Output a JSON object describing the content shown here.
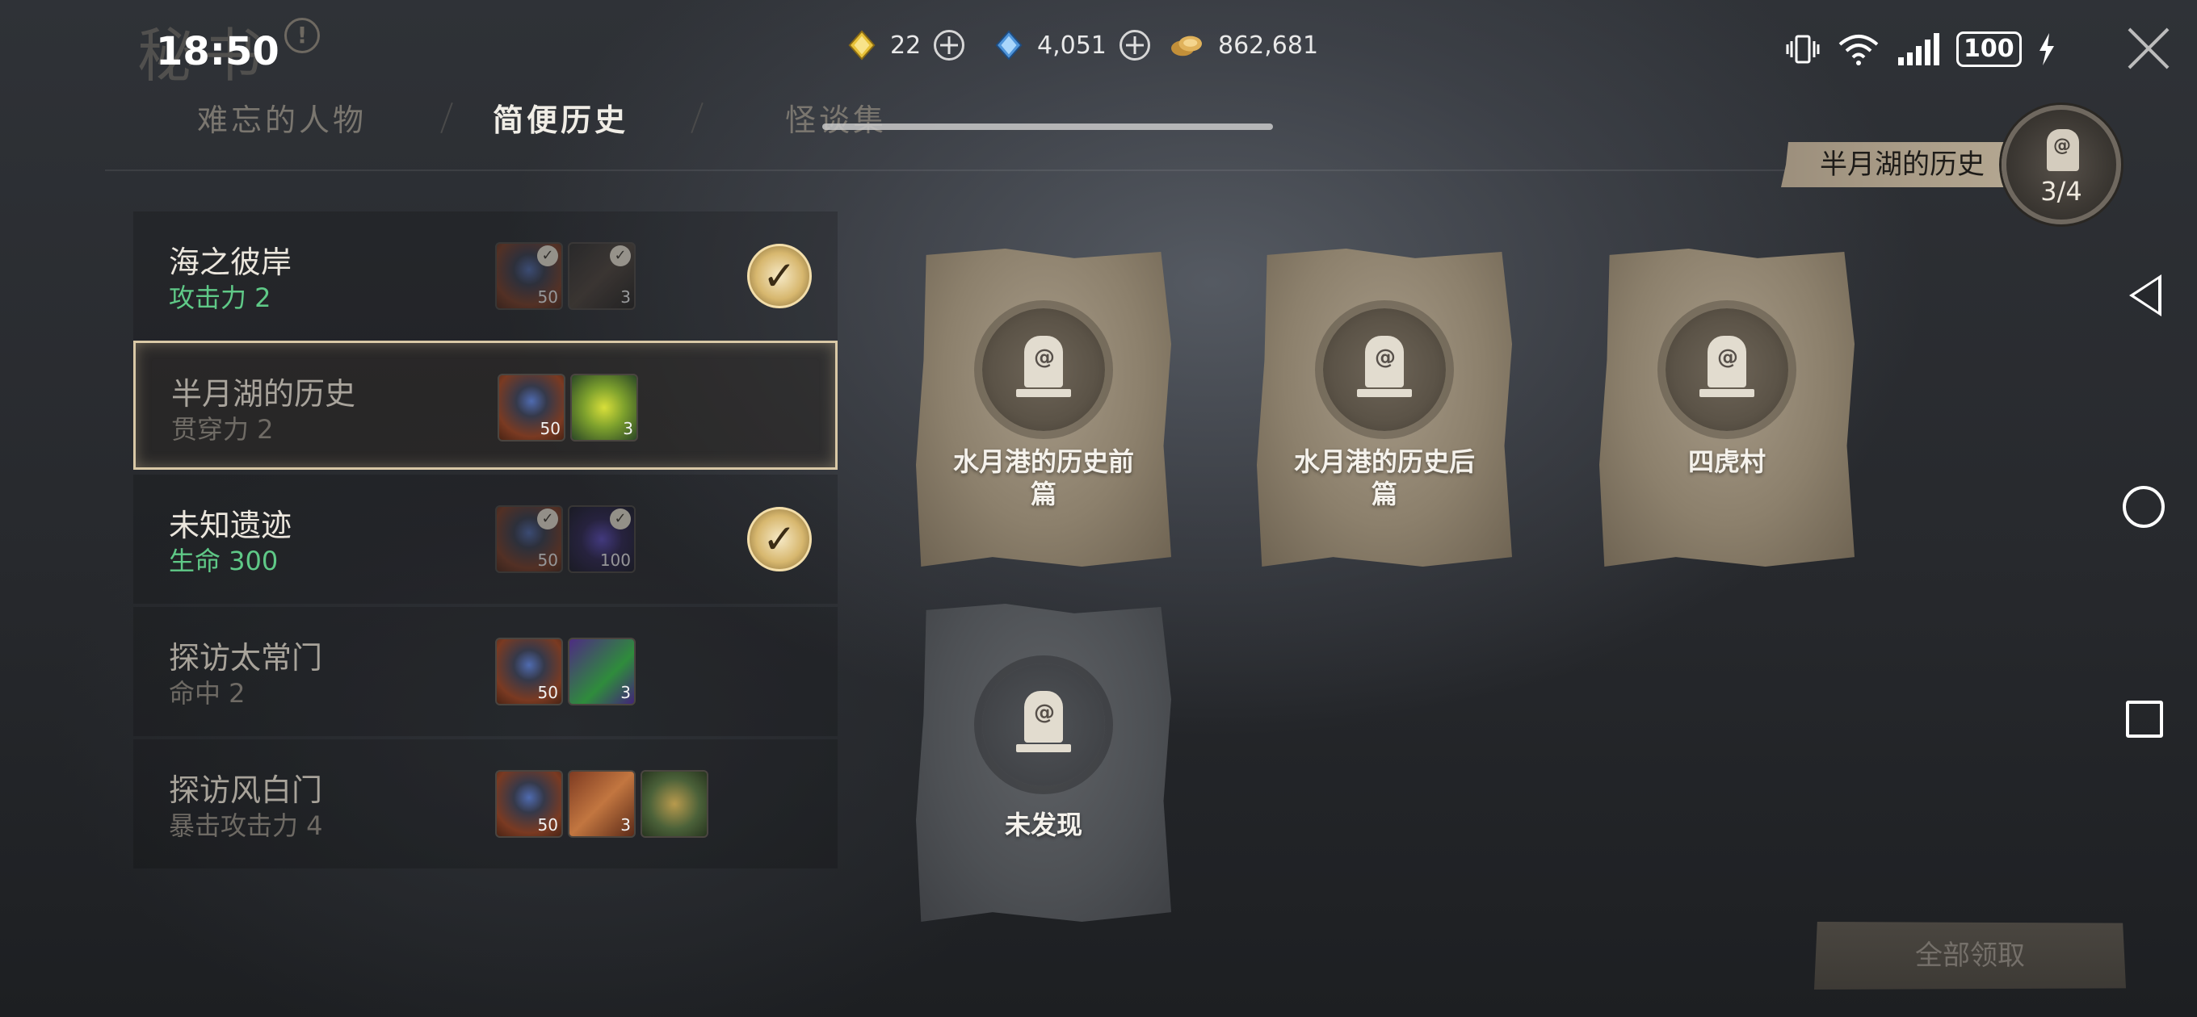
{
  "header": {
    "title_art": "秘书",
    "clock": "18:50"
  },
  "currencies": [
    {
      "icon": "yellow-diamond-icon",
      "value": "22",
      "color": "#e8c23a"
    },
    {
      "icon": "blue-diamond-icon",
      "value": "4,051",
      "color": "#5aa7e8"
    },
    {
      "icon": "coins-icon",
      "value": "862,681",
      "color": "#d2a24a"
    }
  ],
  "status_bar": {
    "battery": "100",
    "icons": [
      "vibrate-icon",
      "wifi-icon",
      "signal-icon",
      "battery-icon",
      "charging-icon"
    ]
  },
  "tabs": [
    {
      "label": "难忘的人物",
      "active": false
    },
    {
      "label": "简便历史",
      "active": true
    },
    {
      "label": "怪谈集",
      "active": false
    }
  ],
  "region": {
    "label": "半月湖的历史",
    "progress": "3/4"
  },
  "quests": [
    {
      "title": "海之彼岸",
      "reward_stat": "攻击力 2",
      "state": "done",
      "items": [
        {
          "kind": "bag",
          "qty": "50",
          "claimed": true
        },
        {
          "kind": "chest-dark",
          "qty": "3",
          "claimed": true
        }
      ]
    },
    {
      "title": "半月湖的历史",
      "reward_stat": "贯穿力 2",
      "state": "selected",
      "items": [
        {
          "kind": "bag",
          "qty": "50",
          "claimed": false
        },
        {
          "kind": "chest-green",
          "qty": "3",
          "claimed": false
        }
      ]
    },
    {
      "title": "未知遗迹",
      "reward_stat": "生命 300",
      "state": "done",
      "items": [
        {
          "kind": "bag",
          "qty": "50",
          "claimed": true
        },
        {
          "kind": "star",
          "qty": "100",
          "claimed": true
        }
      ]
    },
    {
      "title": "探访太常门",
      "reward_stat": "命中 2",
      "state": "pending",
      "items": [
        {
          "kind": "bag",
          "qty": "50",
          "claimed": false
        },
        {
          "kind": "card",
          "qty": "3",
          "claimed": false
        }
      ]
    },
    {
      "title": "探访风白门",
      "reward_stat": "暴击攻击力 4",
      "state": "pending",
      "items": [
        {
          "kind": "bag",
          "qty": "50",
          "claimed": false
        },
        {
          "kind": "scroll",
          "qty": "3",
          "claimed": false
        },
        {
          "kind": "box-green",
          "qty": "",
          "claimed": false
        }
      ]
    }
  ],
  "records": [
    {
      "title": "水月港的历史前篇",
      "line1": "水月港的历史前",
      "line2": "篇",
      "discovered": true
    },
    {
      "title": "水月港的历史后篇",
      "line1": "水月港的历史后",
      "line2": "篇",
      "discovered": true
    },
    {
      "title": "四虎村",
      "line1": "四虎村",
      "line2": "",
      "discovered": true
    },
    {
      "title": "未发现",
      "line1": "未发现",
      "line2": "",
      "discovered": false
    }
  ],
  "actions": {
    "claim_all": "全部领取"
  },
  "nav": [
    "back-icon",
    "home-icon",
    "recents-icon"
  ]
}
